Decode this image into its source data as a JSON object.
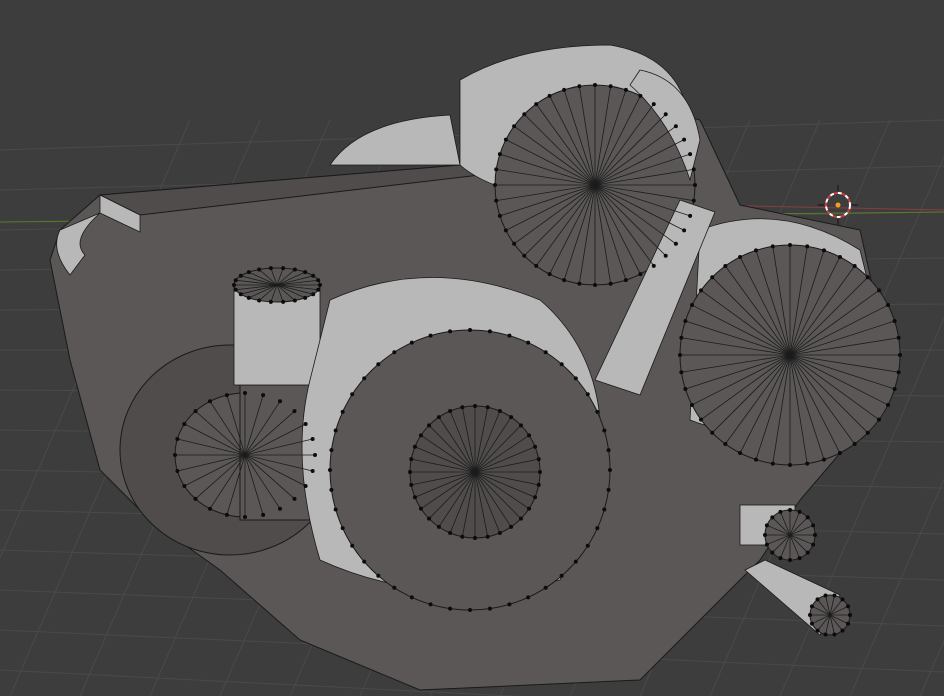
{
  "viewport": {
    "mode": "edit-mesh",
    "shading": "solid",
    "background_color": "#3d3d3d",
    "grid_color": "#4a4a4a",
    "x_axis_color": "#8a3b44",
    "y_axis_color": "#5a7d2a",
    "mesh_face_color": "#5a5756",
    "mesh_edge_color": "#1a1a1a",
    "vertex_color": "#0c0c0c"
  },
  "scene": {
    "object": "camera-body-mesh",
    "cursor_icon": "3d-cursor-icon",
    "cursor_color": "#d23b3b"
  },
  "icons": [
    "3d-cursor-icon"
  ]
}
